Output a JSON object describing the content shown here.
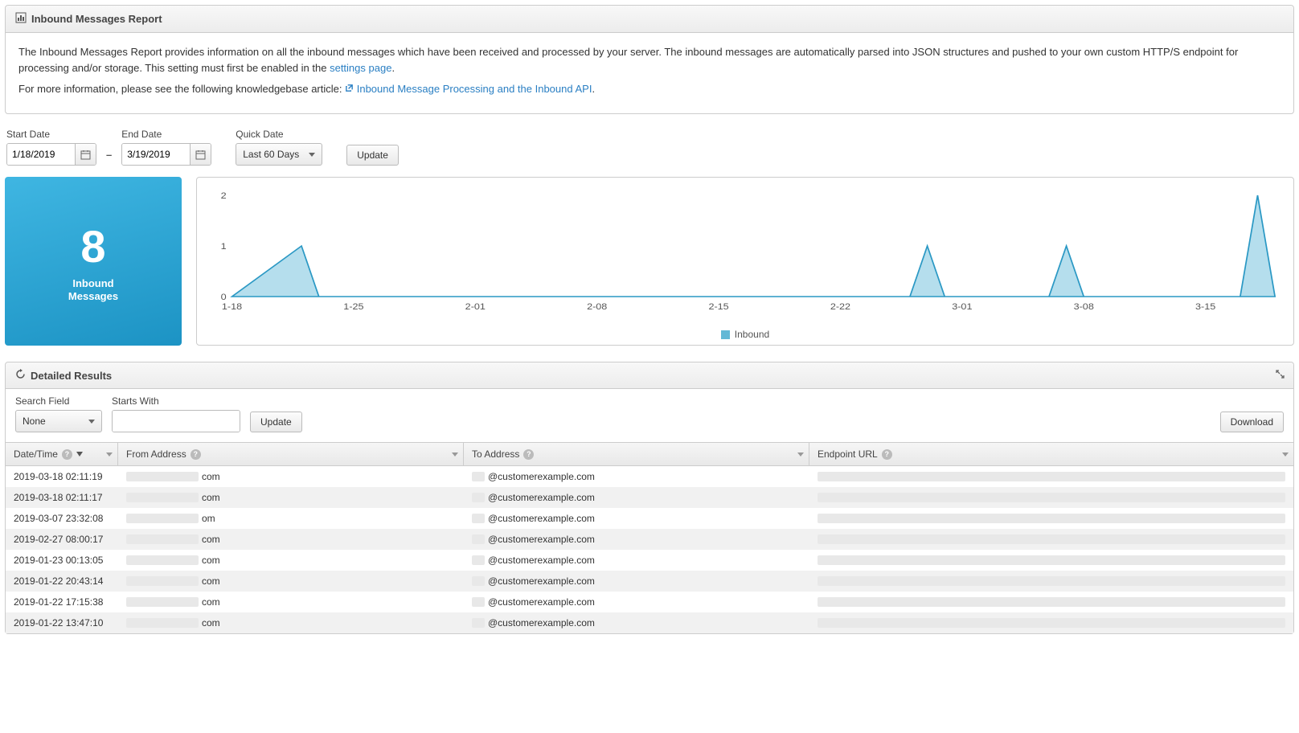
{
  "header": {
    "title": "Inbound Messages Report"
  },
  "desc": {
    "p1a": "The Inbound Messages Report provides information on all the inbound messages which have been received and processed by your server. The inbound messages are automatically parsed into JSON structures and pushed to your own custom HTTP/S endpoint for processing and/or storage. This setting must first be enabled in the ",
    "p1_link": "settings page",
    "p1b": ".",
    "p2a": "For more information, please see the following knowledgebase article:  ",
    "p2_link": "Inbound Message Processing and the Inbound API",
    "p2b": "."
  },
  "filters": {
    "start_label": "Start Date",
    "start_value": "1/18/2019",
    "end_label": "End Date",
    "end_value": "3/19/2019",
    "quick_label": "Quick Date",
    "quick_value": "Last 60 Days",
    "update_label": "Update"
  },
  "tile": {
    "value": "8",
    "label_l1": "Inbound",
    "label_l2": "Messages"
  },
  "chart_data": {
    "type": "area",
    "title": "",
    "xlabel": "",
    "ylabel": "",
    "ylim": [
      0,
      2
    ],
    "yticks": [
      0,
      1,
      2
    ],
    "legend": [
      "Inbound"
    ],
    "x_tick_labels": [
      "1-18",
      "1-25",
      "2-01",
      "2-08",
      "2-15",
      "2-22",
      "3-01",
      "3-08",
      "3-15"
    ],
    "series": [
      {
        "name": "Inbound",
        "x": [
          "1-18",
          "1-22",
          "1-23",
          "1-24",
          "1-25",
          "2-26",
          "2-27",
          "2-28",
          "3-01",
          "3-06",
          "3-07",
          "3-08",
          "3-09",
          "3-17",
          "3-18",
          "3-19"
        ],
        "y": [
          0,
          1,
          0,
          0,
          0,
          0,
          1,
          0,
          0,
          0,
          1,
          0,
          0,
          0,
          2,
          0
        ]
      }
    ]
  },
  "detailed": {
    "title": "Detailed Results",
    "search_field_label": "Search Field",
    "search_field_value": "None",
    "starts_with_label": "Starts With",
    "starts_with_value": "",
    "update_label": "Update",
    "download_label": "Download",
    "columns": {
      "datetime": "Date/Time",
      "from": "From Address",
      "to": "To Address",
      "endpoint": "Endpoint URL"
    },
    "rows": [
      {
        "dt": "2019-03-18 02:11:19",
        "from_suffix": "com",
        "to_suffix": "@customerexample.com"
      },
      {
        "dt": "2019-03-18 02:11:17",
        "from_suffix": "com",
        "to_suffix": "@customerexample.com"
      },
      {
        "dt": "2019-03-07 23:32:08",
        "from_suffix": "om",
        "to_suffix": "@customerexample.com"
      },
      {
        "dt": "2019-02-27 08:00:17",
        "from_suffix": "com",
        "to_suffix": "@customerexample.com"
      },
      {
        "dt": "2019-01-23 00:13:05",
        "from_suffix": "com",
        "to_suffix": "@customerexample.com"
      },
      {
        "dt": "2019-01-22 20:43:14",
        "from_suffix": "com",
        "to_suffix": "@customerexample.com"
      },
      {
        "dt": "2019-01-22 17:15:38",
        "from_suffix": "com",
        "to_suffix": "@customerexample.com"
      },
      {
        "dt": "2019-01-22 13:47:10",
        "from_suffix": "com",
        "to_suffix": "@customerexample.com"
      }
    ]
  }
}
